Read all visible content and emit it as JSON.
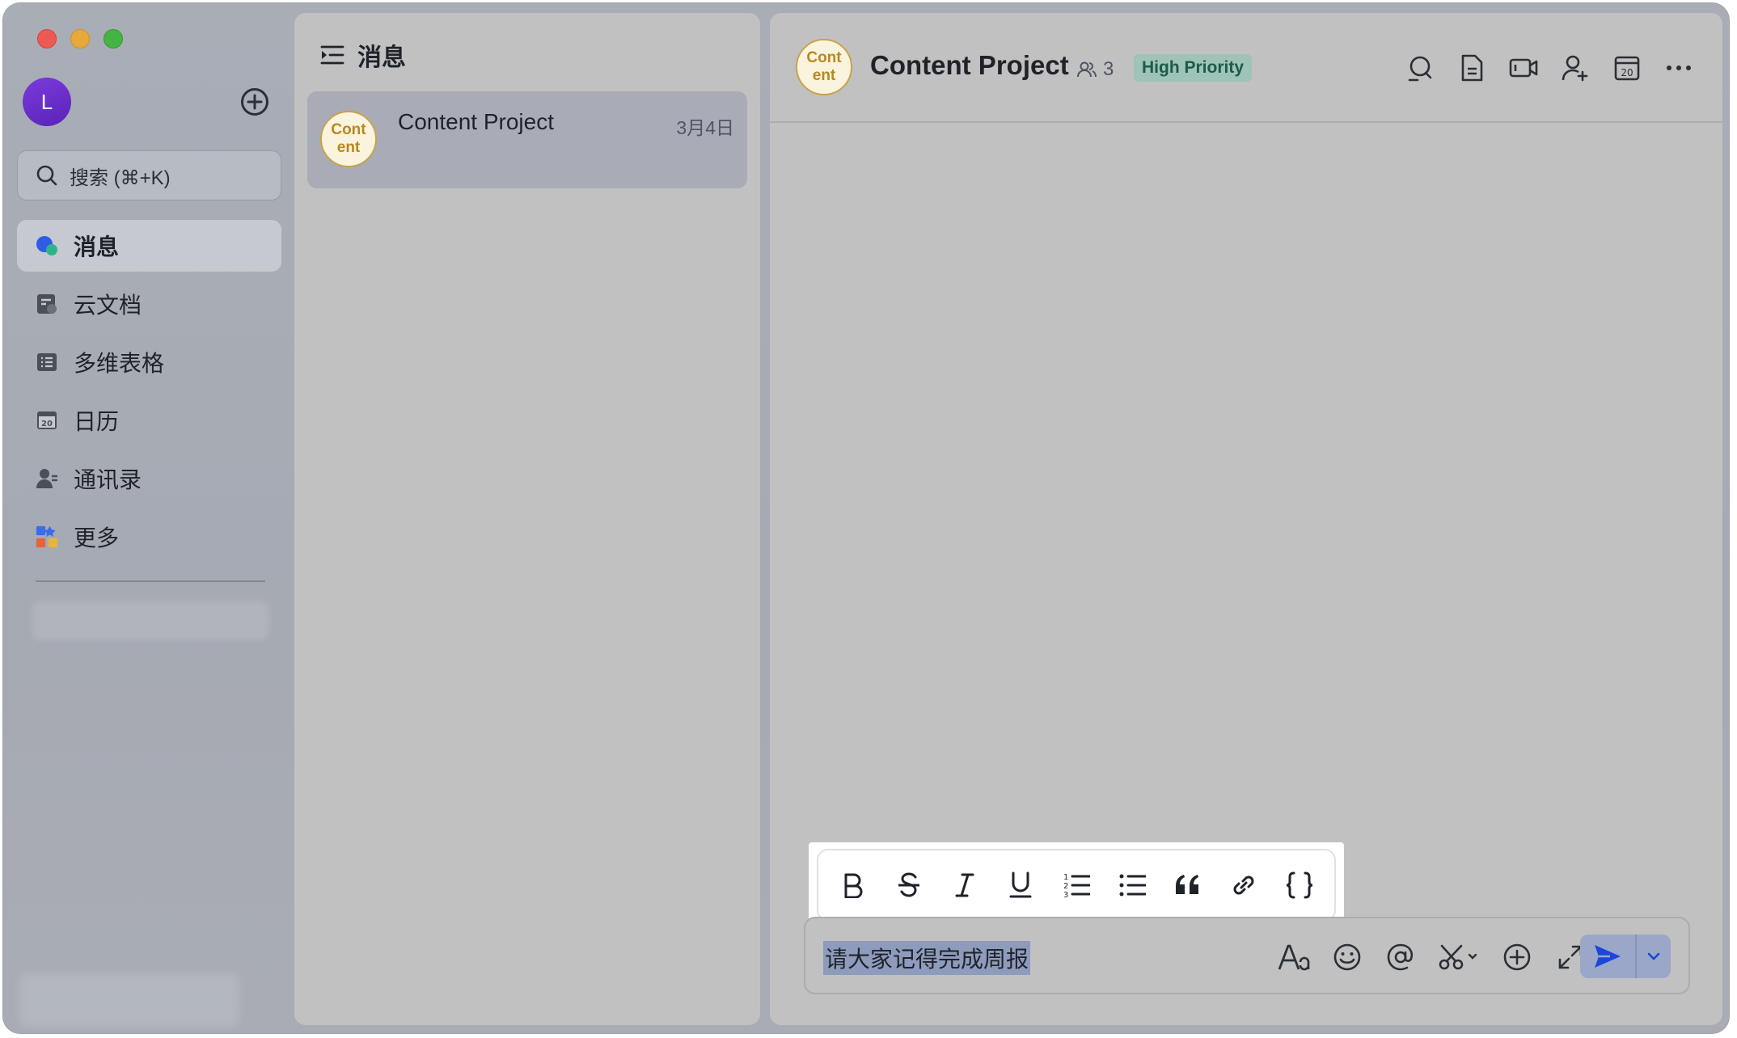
{
  "window": {
    "controls": [
      "close",
      "minimize",
      "maximize"
    ]
  },
  "sidebar": {
    "user_initial": "L",
    "search_placeholder": "搜索 (⌘+K)",
    "items": [
      {
        "label": "消息",
        "icon": "message-icon",
        "active": true
      },
      {
        "label": "云文档",
        "icon": "cloud-doc-icon",
        "active": false
      },
      {
        "label": "多维表格",
        "icon": "table-icon",
        "active": false
      },
      {
        "label": "日历",
        "icon": "calendar-icon",
        "active": false
      },
      {
        "label": "通讯录",
        "icon": "contacts-icon",
        "active": false
      },
      {
        "label": "更多",
        "icon": "apps-icon",
        "active": false
      }
    ]
  },
  "list": {
    "title": "消息",
    "conversations": [
      {
        "avatar_line1": "Cont",
        "avatar_line2": "ent",
        "name": "Content Project",
        "date": "3月4日"
      }
    ]
  },
  "chat": {
    "avatar_line1": "Cont",
    "avatar_line2": "ent",
    "title": "Content Project",
    "member_count": "3",
    "badge": "High Priority",
    "header_icons": [
      "search-icon",
      "doc-icon",
      "video-icon",
      "add-member-icon",
      "calendar-icon",
      "more-icon"
    ],
    "format_tools": [
      "bold",
      "strikethrough",
      "italic",
      "underline",
      "ordered-list",
      "bullet-list",
      "quote",
      "link",
      "code-block"
    ],
    "composer_text": "请大家记得完成周报",
    "composer_icons": [
      "font-icon",
      "emoji-icon",
      "mention-icon",
      "scissors-icon",
      "plus-icon",
      "expand-icon"
    ]
  },
  "colors": {
    "badge_bg": "#9fc3b9",
    "badge_text": "#1c5a4b",
    "send": "#1a47d8",
    "avatar_border": "#c9a34a"
  }
}
